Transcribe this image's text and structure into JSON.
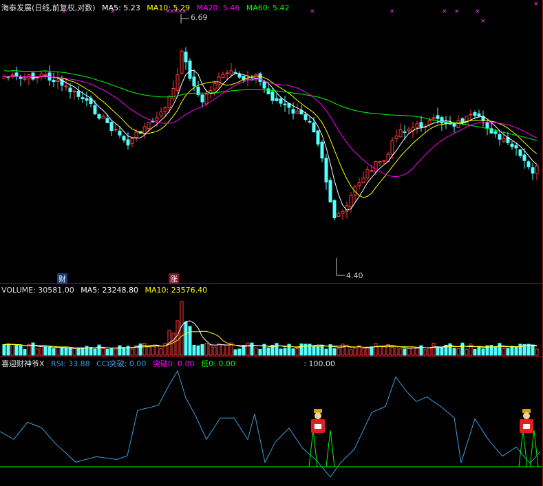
{
  "main_header": {
    "title": "海泰发展(日线,前复权,对数)",
    "ma5_label": "MA5: 5.23",
    "ma10_label": "MA10: 5.29",
    "ma20_label": "MA20: 5.46",
    "ma60_label": "MA60: 5.42"
  },
  "main_markers": {
    "high_label": "6.69",
    "low_label": "4.40",
    "tag_cai": "财",
    "tag_zhang": "涨"
  },
  "volume_header": {
    "volume_label": "VOLUME: 30581.00",
    "ma5_label": "MA5: 23248.80",
    "ma10_label": "MA10: 23576.40"
  },
  "indicator_header": {
    "name": "喜迎财神爷X",
    "rsi_label": "RSI: 33.88",
    "cci_label": "CCI突破: 0.00",
    "tupo_label": "突破0: 0.00",
    "di_label": "低0: 0.00",
    "level_label": ": 100.00"
  },
  "colors": {
    "up": "#ff3c3c",
    "down": "#54ffff",
    "ma5": "#ffffff",
    "ma10": "#ffff00",
    "ma20": "#ff00ff",
    "ma60": "#00ff00",
    "rsi": "#3aa0e0",
    "base_line": "#00ff00",
    "separator": "#8b1a1a"
  },
  "chart_data": [
    {
      "type": "candlestick",
      "title": "海泰发展(日线,前复权,对数)",
      "price_high": 6.69,
      "price_low": 4.4,
      "series": [
        {
          "name": "MA5",
          "last": 5.23
        },
        {
          "name": "MA10",
          "last": 5.29
        },
        {
          "name": "MA20",
          "last": 5.46
        },
        {
          "name": "MA60",
          "last": 5.42
        }
      ]
    },
    {
      "type": "bar",
      "title": "VOLUME",
      "series": [
        {
          "name": "VOLUME",
          "last": 30581.0
        },
        {
          "name": "MA5",
          "last": 23248.8
        },
        {
          "name": "MA10",
          "last": 23576.4
        }
      ]
    },
    {
      "type": "line",
      "title": "喜迎财神爷X",
      "series": [
        {
          "name": "RSI",
          "last": 33.88
        },
        {
          "name": "CCI突破",
          "last": 0.0
        },
        {
          "name": "突破0",
          "last": 0.0
        },
        {
          "name": "低0",
          "last": 0.0
        }
      ],
      "level": 100.0
    }
  ]
}
